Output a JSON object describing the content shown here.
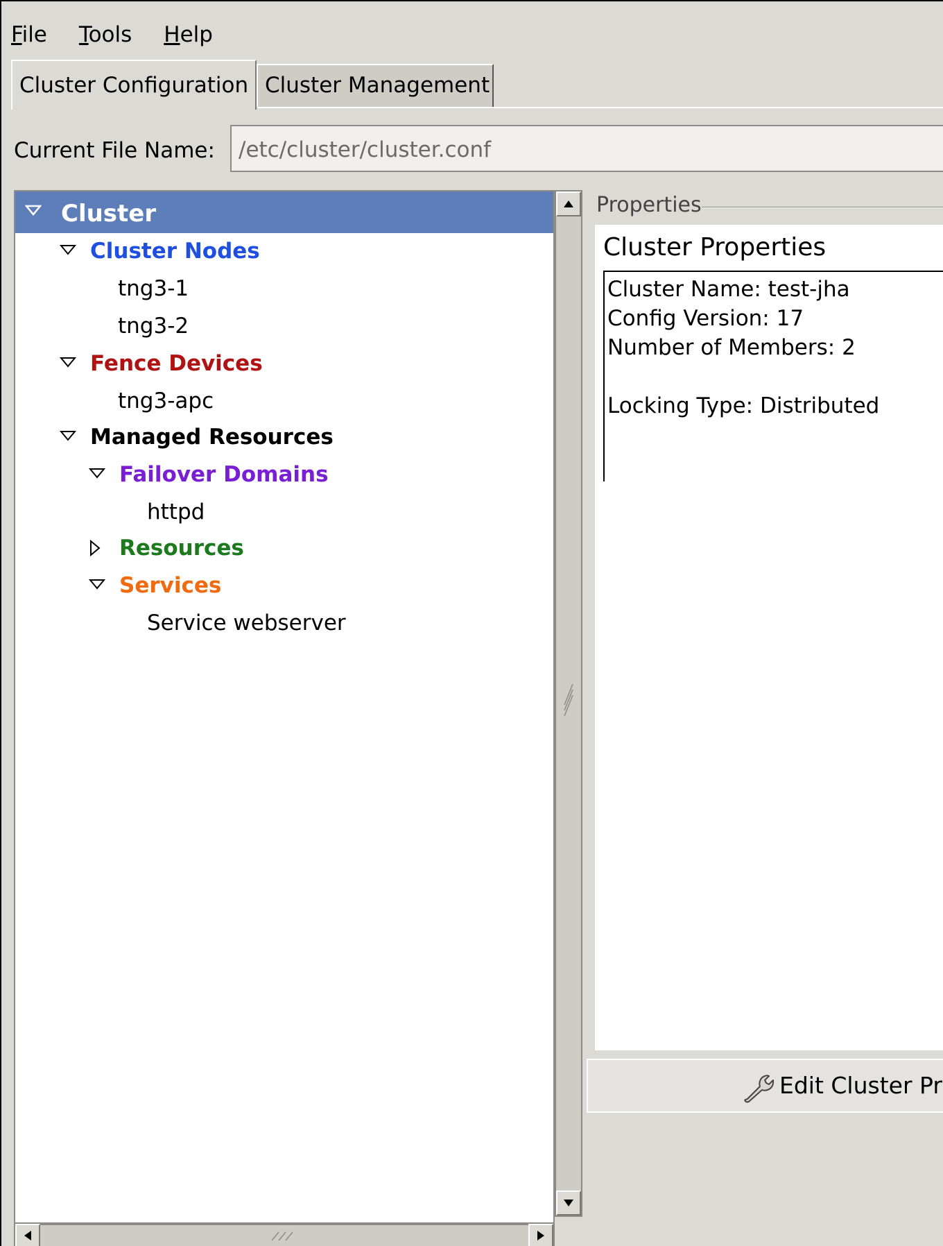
{
  "menubar": {
    "file": {
      "mnemonic": "F",
      "rest": "ile"
    },
    "tools": {
      "mnemonic": "T",
      "rest": "ools"
    },
    "help": {
      "mnemonic": "H",
      "rest": "elp"
    }
  },
  "tabs": [
    {
      "label": "Cluster Configuration",
      "active": true
    },
    {
      "label": "Cluster Management",
      "active": false
    }
  ],
  "file": {
    "label": "Current File Name:",
    "value": "/etc/cluster/cluster.conf"
  },
  "tree": {
    "root": {
      "label": "Cluster",
      "expanded": true,
      "selected": true
    },
    "cluster_nodes": {
      "label": "Cluster Nodes",
      "color": "#1f4fe0",
      "expanded": true,
      "items": [
        "tng3-1",
        "tng3-2"
      ]
    },
    "fence_devices": {
      "label": "Fence Devices",
      "color": "#b01212",
      "expanded": true,
      "items": [
        "tng3-apc"
      ]
    },
    "managed_resources": {
      "label": "Managed Resources",
      "color": "#000000",
      "expanded": true
    },
    "failover_domains": {
      "label": "Failover Domains",
      "color": "#7a1ed6",
      "expanded": true,
      "items": [
        "httpd"
      ]
    },
    "resources": {
      "label": "Resources",
      "color": "#1b7a1b",
      "expanded": false
    },
    "services": {
      "label": "Services",
      "color": "#f26a10",
      "expanded": true,
      "items": [
        "Service webserver"
      ]
    }
  },
  "properties": {
    "legend": "Properties",
    "title": "Cluster Properties",
    "lines": [
      "Cluster Name: test-jha",
      "Config Version: 17",
      "Number of Members: 2",
      "",
      "Locking Type: Distributed"
    ],
    "edit_button": "Edit Cluster Pr"
  },
  "colors": {
    "selection": "#5d7eb8",
    "background": "#dcdad5"
  }
}
